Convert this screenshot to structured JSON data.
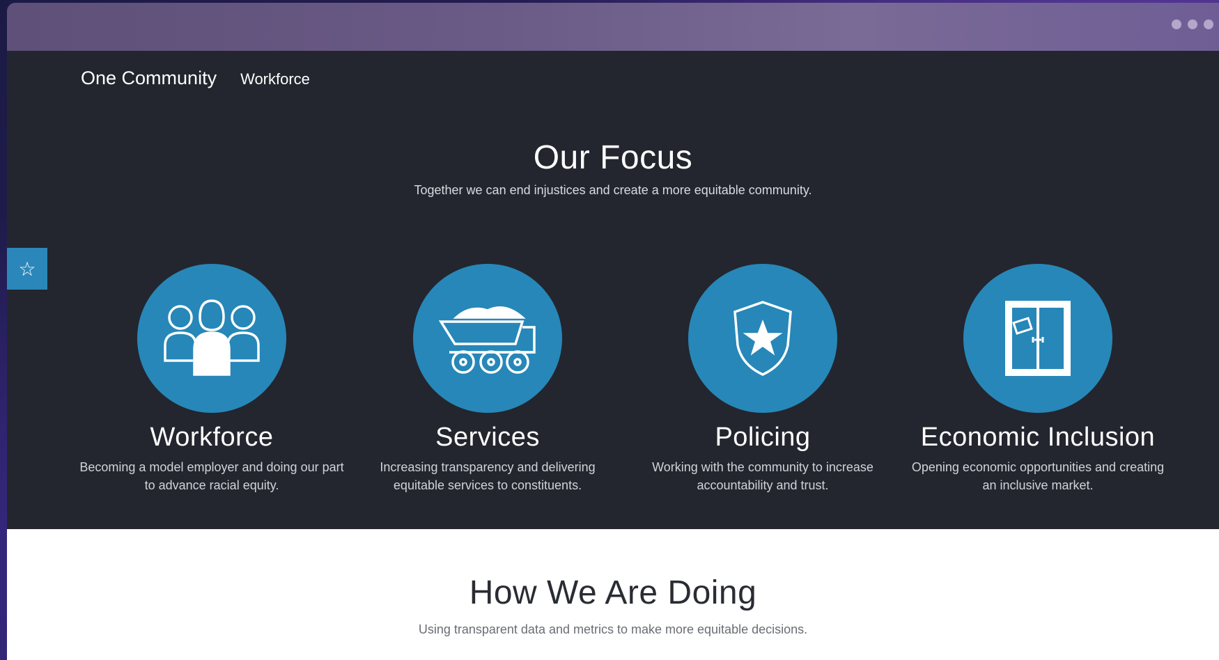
{
  "nav": {
    "brand": "One Community",
    "link": "Workforce"
  },
  "focus": {
    "title": "Our Focus",
    "subtitle": "Together we can end injustices and create a more equitable community."
  },
  "cards": [
    {
      "title": "Workforce",
      "desc": "Becoming a model employer and doing our part to advance racial equity.",
      "icon": "people-icon"
    },
    {
      "title": "Services",
      "desc": "Increasing transparency and delivering equitable services to constituents.",
      "icon": "dump-truck-icon"
    },
    {
      "title": "Policing",
      "desc": "Working with the community to increase accountability and trust.",
      "icon": "police-badge-icon"
    },
    {
      "title": "Economic Inclusion",
      "desc": "Opening economic opportunities and creating an inclusive market.",
      "icon": "open-door-sign-icon"
    }
  ],
  "doing": {
    "title": "How We Are Doing",
    "subtitle": "Using transparent data and metrics to make more equitable decisions."
  },
  "side_tab": {
    "icon": "star-icon"
  },
  "colors": {
    "accent": "#2787b8",
    "dark_bg": "#23262e",
    "light_bg": "#ffffff"
  }
}
